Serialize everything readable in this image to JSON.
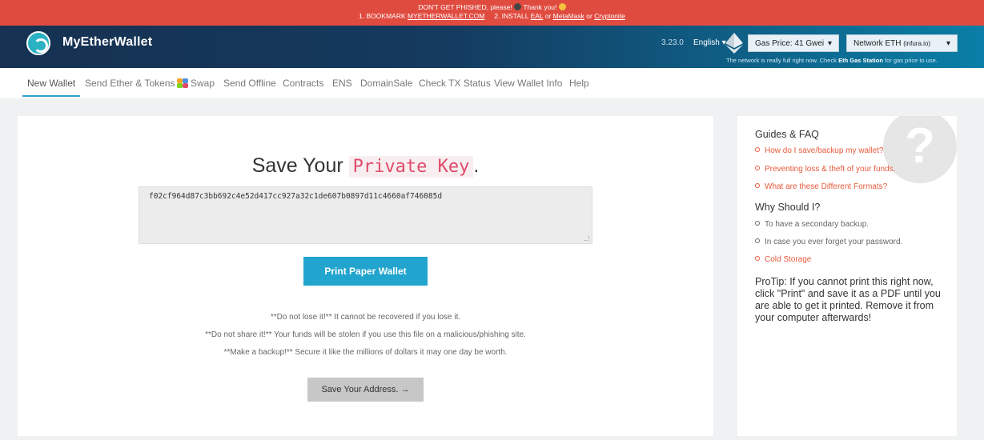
{
  "banner": {
    "line1_pre": "DON'T GET PHISHED, please!",
    "line1_post": "Thank you!",
    "line2_pre": "1. BOOKMARK",
    "bookmark_link": "MYETHERWALLET.COM",
    "line2_mid": "2. INSTALL",
    "eal_link": "EAL",
    "or1": "or",
    "metamask_link": "MetaMask",
    "or2": "or",
    "cryptonite_link": "Cryptonite"
  },
  "header": {
    "brand": "MyEtherWallet",
    "version": "3.23.0",
    "language": "English",
    "gas_price": "Gas Price: 41 Gwei",
    "network": "Network ETH",
    "network_provider": "(infura.io)",
    "gas_note_pre": "The network is really full right now. Check",
    "gas_note_link": "Eth Gas Station",
    "gas_note_post": "for gas price to use."
  },
  "nav": {
    "items": [
      "New Wallet",
      "Send Ether & Tokens",
      "Swap",
      "Send Offline",
      "Contracts",
      "ENS",
      "DomainSale",
      "Check TX Status",
      "View Wallet Info",
      "Help"
    ]
  },
  "main": {
    "title_prefix": "Save Your",
    "title_code": "Private Key",
    "title_suffix": ".",
    "private_key": "f02cf964d87c3bb692c4e52d417cc927a32c1de607b0897d11c4660af746085d",
    "print_button": "Print Paper Wallet",
    "warnings": [
      "**Do not lose it!** It cannot be recovered if you lose it.",
      "**Do not share it!** Your funds will be stolen if you use this file on a malicious/phishing site.",
      "**Make a backup!** Secure it like the millions of dollars it may one day be worth."
    ],
    "save_address_button": "Save Your Address. →"
  },
  "sidebar": {
    "guides_heading": "Guides & FAQ",
    "guides": [
      "How do I save/backup my wallet?",
      "Preventing loss & theft of your funds.",
      "What are these Different Formats?"
    ],
    "why_heading": "Why Should I?",
    "why": [
      "To have a secondary backup.",
      "In case you ever forget your password."
    ],
    "why_link": "Cold Storage",
    "protip": "ProTip: If you cannot print this right now, click \"Print\" and save it as a PDF until you are able to get it printed. Remove it from your computer afterwards!"
  },
  "colors": {
    "banner": "#e04b40",
    "accent": "#21a4ce",
    "link": "#e65a3b"
  }
}
